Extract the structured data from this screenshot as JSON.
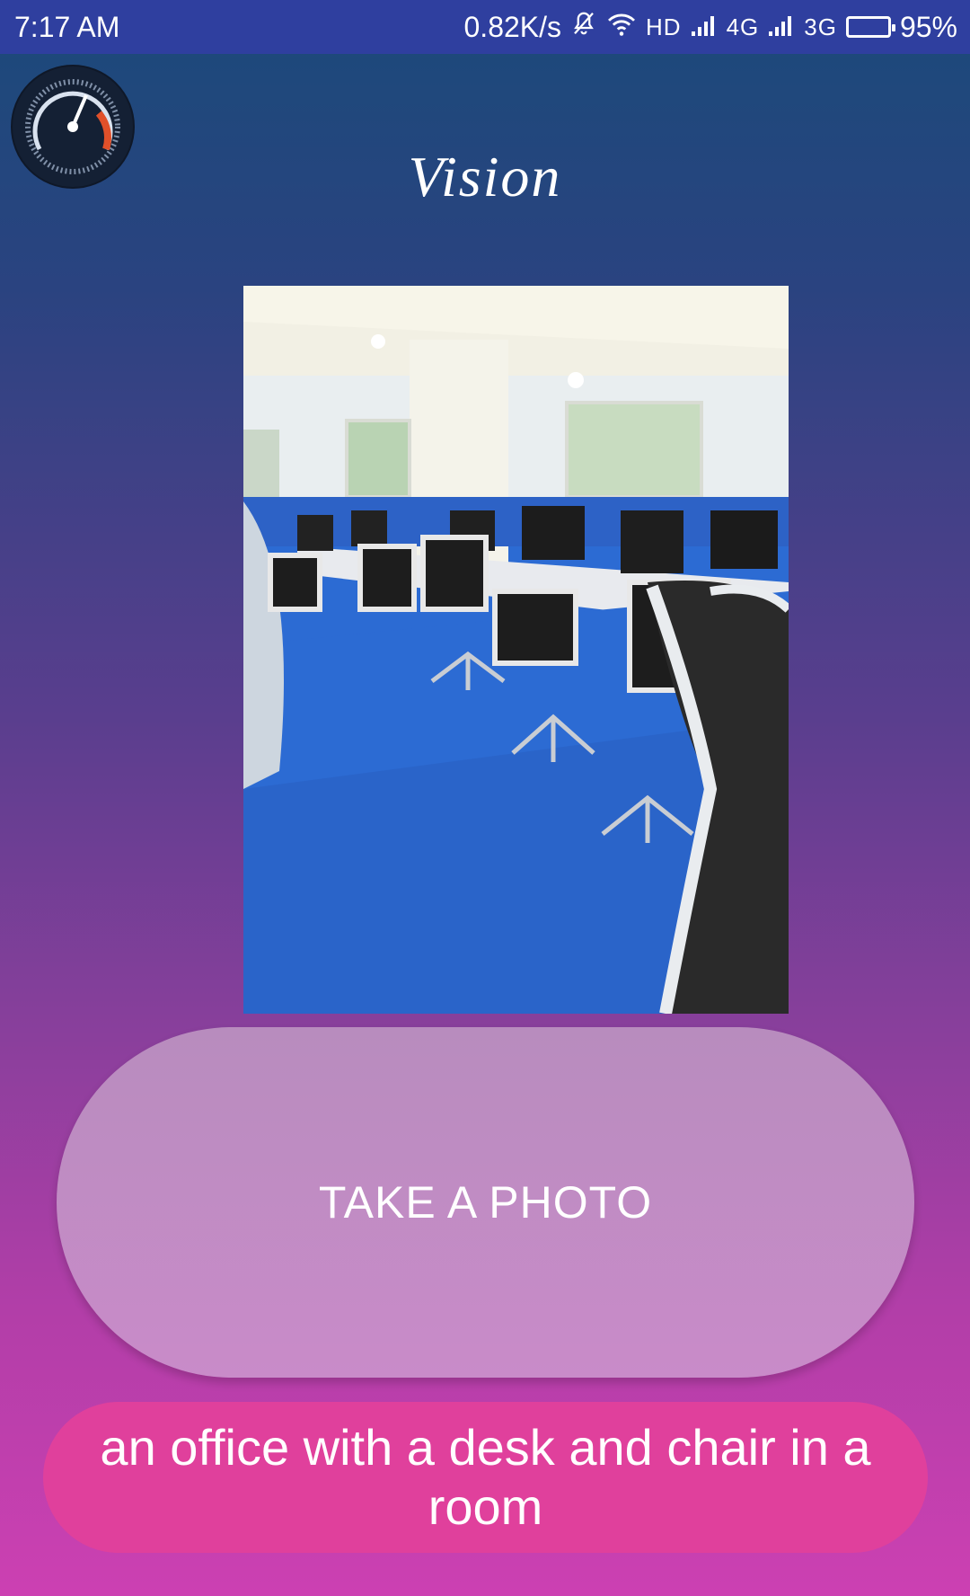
{
  "status_bar": {
    "time": "7:17 AM",
    "network_speed": "0.82K/s",
    "hd_label": "HD",
    "net1": "4G",
    "net2": "3G",
    "battery_percent": "95%",
    "icons": [
      "bell-off-icon",
      "wifi-icon",
      "signal-icon",
      "battery-icon"
    ]
  },
  "app": {
    "title": "Vision",
    "logo_icon": "speedometer-icon"
  },
  "photo": {
    "description_icon": "office-photo"
  },
  "take_photo_button": {
    "label": "TAKE A PHOTO"
  },
  "caption": {
    "text": "an office with a desk and chair in a room"
  },
  "colors": {
    "status_bar": "#2f3f9f",
    "button": "#c28bc5",
    "caption_bg": "#e0409c"
  }
}
